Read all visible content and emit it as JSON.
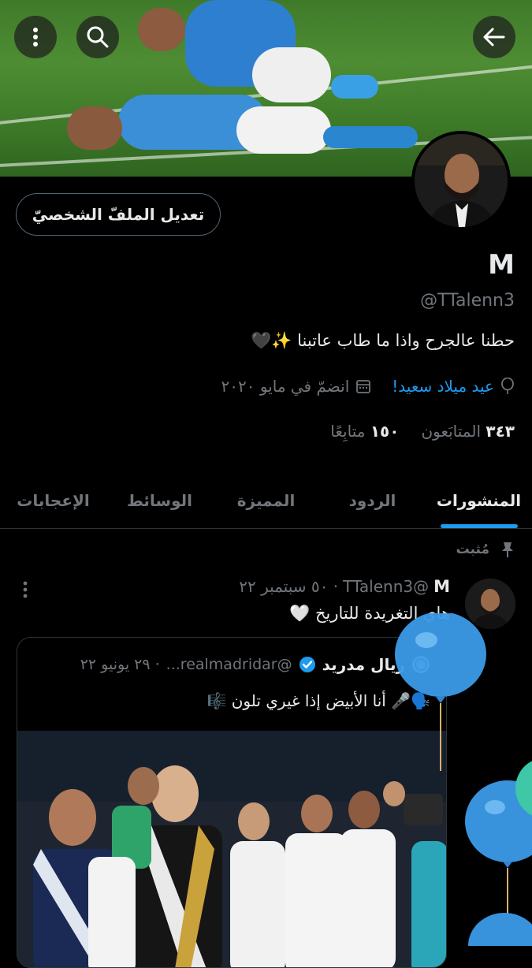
{
  "header": {
    "back_icon": "arrow-left-icon",
    "search_icon": "search-icon",
    "more_icon": "more-vertical-icon"
  },
  "profile": {
    "edit_button": "تعديل الملفّ الشخصيّ",
    "name": "M",
    "handle": "@TTalenn3",
    "bio": "حطنا عالجرح واذا ما طاب عاتبنا ✨🖤",
    "birthday": "عيد ميلاد سعيد!",
    "joined": "انضمّ في مايو ٢٠٢٠",
    "followers_count": "٣٤٣",
    "followers_label": "المتابَعون",
    "following_count": "١٥٠",
    "following_label": "متابِعًا"
  },
  "tabs": [
    {
      "label": "المنشورات"
    },
    {
      "label": "الردود"
    },
    {
      "label": "المميزة"
    },
    {
      "label": "الوسائط"
    },
    {
      "label": "الإعجابات"
    }
  ],
  "pinned": {
    "label": "مُثبت"
  },
  "tweet": {
    "name": "M",
    "handle": "@TTalenn3",
    "date": "· ٥٠ سبتمبر ٢٢",
    "text": "هاي التغريدة للتاريخ 🤍"
  },
  "quote": {
    "name": "ريال مدريد",
    "handle": "@realmadridar...",
    "date": "· ٢٩ يونيو ٢٢",
    "text": "🗣️🎤 أنا الأبيض إذا غيري تلون 🎼"
  },
  "colors": {
    "accent": "#1d9bf0",
    "muted": "#71767b",
    "border": "#2f3336"
  }
}
